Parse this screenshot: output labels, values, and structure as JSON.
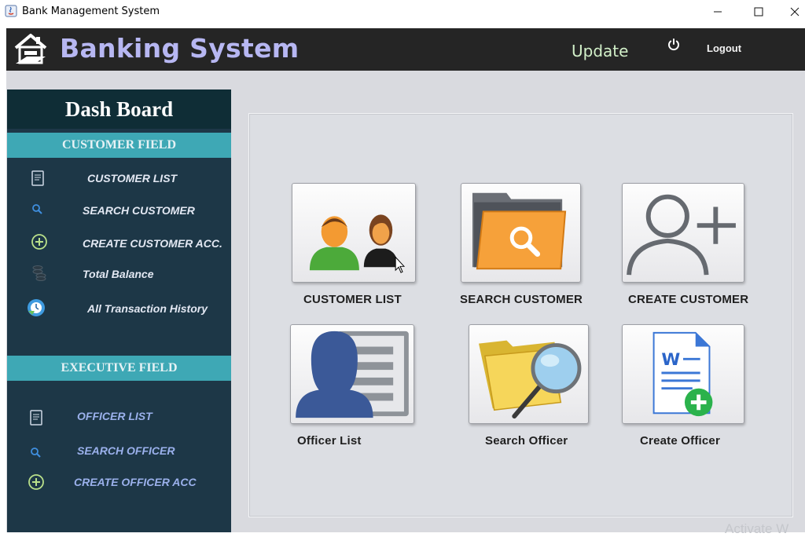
{
  "window": {
    "title": "Bank Management System",
    "controls": {
      "minimize": "—",
      "maximize": "☐",
      "close": "✕"
    }
  },
  "header": {
    "brand": "Banking System",
    "update_label": "Update",
    "logout_label": "Logout"
  },
  "sidebar": {
    "title": "Dash Board",
    "customer_section": "CUSTOMER FIELD",
    "customer_items": [
      {
        "label": "CUSTOMER LIST",
        "icon": "document-icon"
      },
      {
        "label": "SEARCH CUSTOMER",
        "icon": "search-icon"
      },
      {
        "label": "CREATE CUSTOMER ACC.",
        "icon": "plus-circle-icon"
      },
      {
        "label": "Total Balance",
        "icon": "coins-icon"
      },
      {
        "label": "All Transaction History",
        "icon": "history-icon"
      }
    ],
    "executive_section": "EXECUTIVE FIELD",
    "executive_items": [
      {
        "label": "OFFICER LIST",
        "icon": "document-icon"
      },
      {
        "label": "SEARCH OFFICER",
        "icon": "search-icon"
      },
      {
        "label": "CREATE OFFICER ACC",
        "icon": "plus-circle-icon"
      }
    ]
  },
  "tiles": [
    {
      "label": "CUSTOMER LIST",
      "icon": "customers-icon"
    },
    {
      "label": "SEARCH CUSTOMER",
      "icon": "folder-search-icon"
    },
    {
      "label": "CREATE CUSTOMER",
      "icon": "add-user-icon"
    },
    {
      "label": "Officer List",
      "icon": "officer-list-icon"
    },
    {
      "label": "Search Officer",
      "icon": "folder-magnifier-icon"
    },
    {
      "label": "Create Officer",
      "icon": "new-document-icon"
    }
  ],
  "watermark": "Activate W",
  "colors": {
    "header_bg": "#252525",
    "brand": "#b7b7f2",
    "sidebar_bg": "#1d3747",
    "section_bar": "#3ea8b5",
    "content_bg": "#d9dadf"
  }
}
